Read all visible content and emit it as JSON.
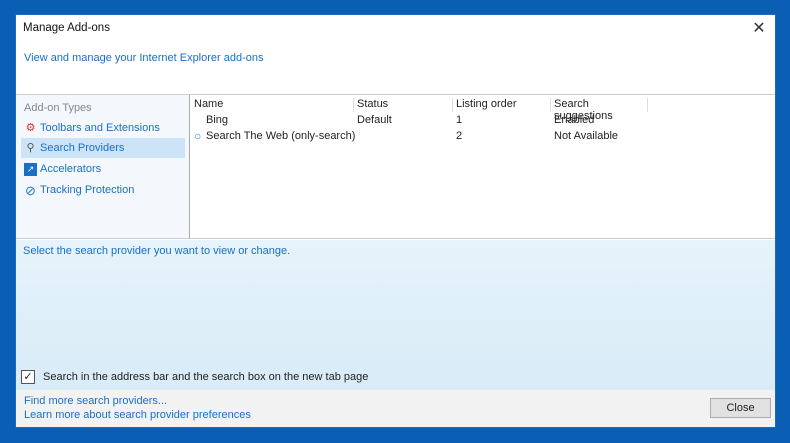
{
  "window": {
    "title": "Manage Add-ons",
    "close_glyph": "✕"
  },
  "header_link": "View and manage your Internet Explorer add-ons",
  "sidebar": {
    "heading": "Add-on Types",
    "items": [
      {
        "label": "Toolbars and Extensions",
        "icon": "gear-blocked-icon",
        "selected": false
      },
      {
        "label": "Search Providers",
        "icon": "search-icon",
        "selected": true
      },
      {
        "label": "Accelerators",
        "icon": "accelerator-icon",
        "selected": false
      },
      {
        "label": "Tracking Protection",
        "icon": "block-icon",
        "selected": false
      }
    ]
  },
  "table": {
    "columns": [
      "Name",
      "Status",
      "Listing order",
      "Search suggestions"
    ],
    "rows": [
      {
        "name": "Bing",
        "status": "Default",
        "order": "1",
        "suggestions": "Enabled"
      },
      {
        "name": "Search The Web (only-search)",
        "status": "",
        "order": "2",
        "suggestions": "Not Available"
      }
    ]
  },
  "description": "Select the search provider you want to view or change.",
  "checkbox": {
    "label": "Search in the address bar and the search box on the new tab page",
    "checked": true,
    "mark": "✓"
  },
  "footer": {
    "links": [
      "Find more search providers...",
      "Learn more about search provider preferences"
    ],
    "close_label": "Close"
  }
}
